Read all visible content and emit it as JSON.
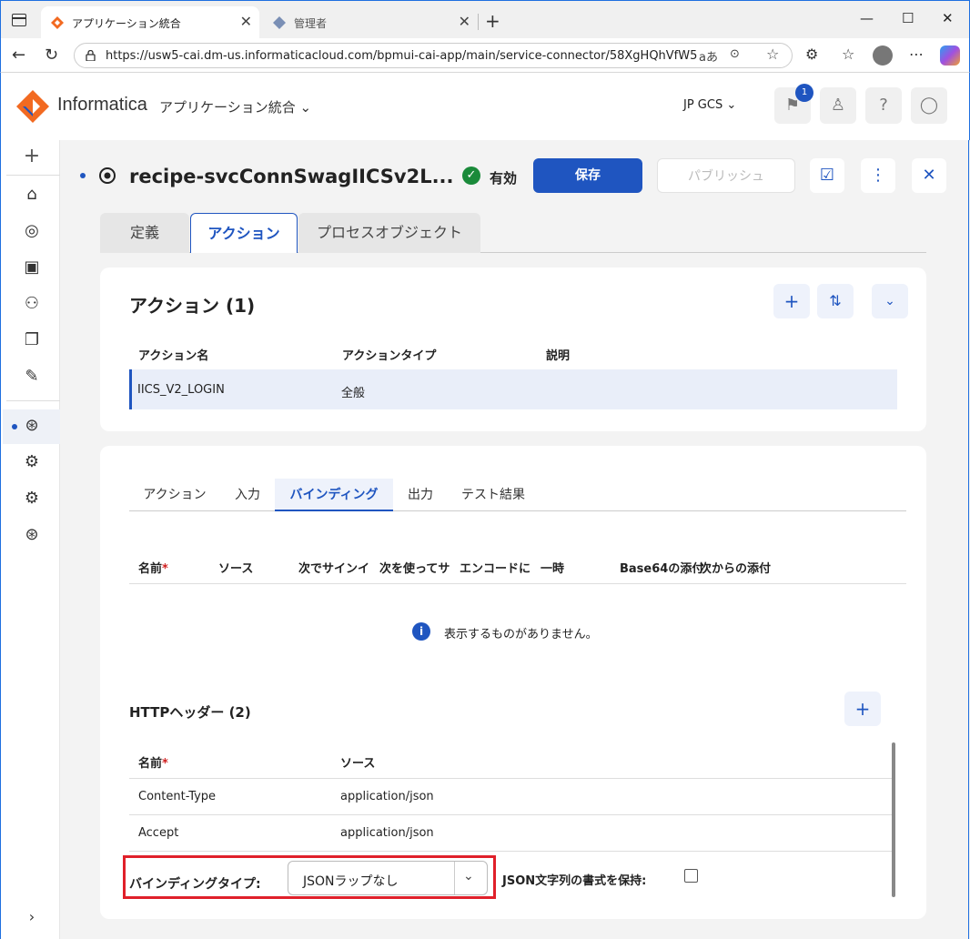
{
  "browser": {
    "active_tab_title": "アプリケーション統合",
    "inactive_tab_title": "管理者",
    "url": "https://usw5-cai.dm-us.informaticacloud.com/bpmui-cai-app/main/service-connector/58XgHQhVfW5b..."
  },
  "header": {
    "brand": "Informatica",
    "app_name": "アプリケーション統合",
    "org_name": "JP GCS",
    "notification_count": "1"
  },
  "page": {
    "title": "recipe-svcConnSwagIICSv2L...",
    "status": "有効",
    "save_label": "保存",
    "publish_label": "パブリッシュ",
    "tabs": [
      "定義",
      "アクション",
      "プロセスオブジェクト"
    ]
  },
  "actions_card": {
    "title": "アクション (1)",
    "columns": [
      "アクション名",
      "アクションタイプ",
      "説明"
    ],
    "rows": [
      {
        "name": "IICS_V2_LOGIN",
        "type": "全般",
        "description": ""
      }
    ]
  },
  "detail_card": {
    "subtabs": [
      "アクション",
      "入力",
      "バインディング",
      "出力",
      "テスト結果"
    ],
    "active_subtab": "バインディング",
    "binding_columns": [
      "名前",
      "ソース",
      "次でサインイ",
      "次を使ってサ",
      "エンコードに",
      "一時",
      "Base64の添付",
      "次からの添付"
    ],
    "empty_message": "表示するものがありません。",
    "http_headers_title": "HTTPヘッダー (2)",
    "header_columns": [
      "名前",
      "ソース"
    ],
    "header_rows": [
      {
        "name": "Content-Type",
        "source": "application/json"
      },
      {
        "name": "Accept",
        "source": "application/json"
      }
    ],
    "binding_type_label": "バインディングタイプ:",
    "binding_type_value": "JSONラップなし",
    "json_format_label": "JSON文字列の書式を保持:",
    "json_format_checked": false
  },
  "colors": {
    "accent": "#1f55c0",
    "status_green": "#1a8a3a",
    "highlight_red": "#e0202a"
  }
}
